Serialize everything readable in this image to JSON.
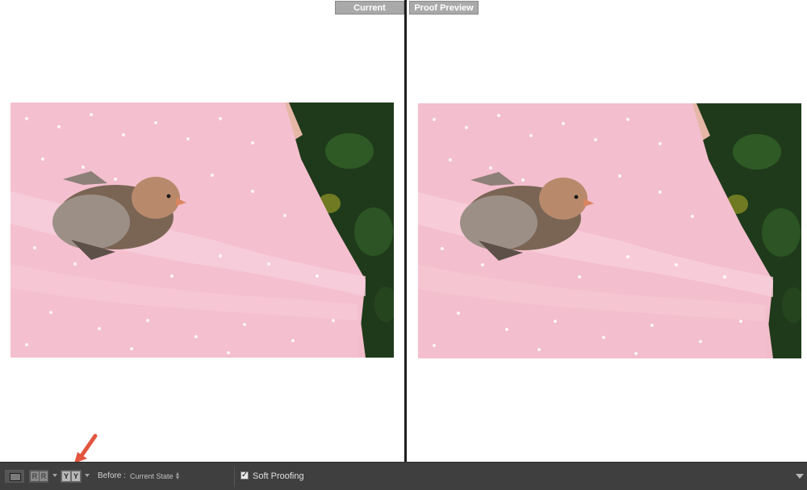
{
  "panes": {
    "left": {
      "tag": "Current"
    },
    "right": {
      "tag": "Proof Preview"
    }
  },
  "toolbar": {
    "before_label": "Before :",
    "before_value": "Current State",
    "soft_proofing_label": "Soft Proofing",
    "soft_proofing_checked": true,
    "view_loupe_icon": "loupe-view-icon",
    "view_rr_icon": "before-after-left-right-icon",
    "view_yy_icon": "before-after-split-icon",
    "rr_glyph_a": "R",
    "rr_glyph_b": "R",
    "yy_glyph_a": "Y",
    "yy_glyph_b": "Y",
    "check_glyph": "✓"
  },
  "colors": {
    "toolbar_bg": "#3f3f3f",
    "tag_bg": "#a9a9a9",
    "divider": "#1e1e1e",
    "arrow": "#e2553f"
  }
}
